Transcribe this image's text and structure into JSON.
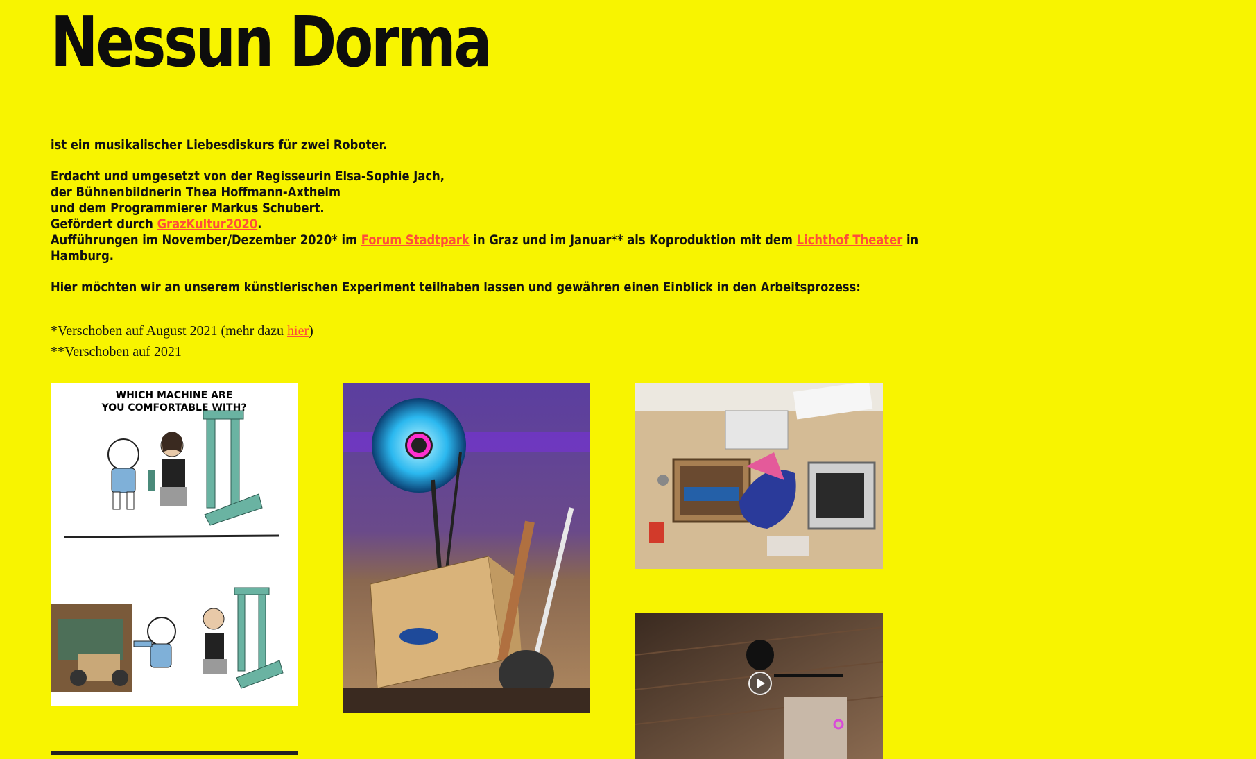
{
  "title": "Nessun Dorma",
  "intro": {
    "line1": "ist ein musikalischer Liebesdiskurs für zwei Roboter.",
    "credit1_prefix": "Erdacht und umgesetzt von der Regisseurin ",
    "credit1_name": "Elsa-Sophie Jach,",
    "credit2_prefix": "der Bühnenbildnerin ",
    "credit2_name": "Thea Hoffmann-Axthelm",
    "credit3_prefix": "und dem Programmierer ",
    "credit3_name": "Markus Schubert.",
    "funding_prefix": "Gefördert durch ",
    "funding_link": "GrazKultur2020",
    "funding_suffix": ".",
    "perf_prefix": "Aufführungen im November/Dezember 2020* im ",
    "perf_link1": "Forum Stadtpark",
    "perf_mid": " in Graz und im Januar** als Koproduktion mit dem ",
    "perf_link2": "Lichthof Theater",
    "perf_suffix": " in",
    "perf_line2": "Hamburg.",
    "experiment": "Hier möchten wir an unserem künstlerischen Experiment teilhaben lassen und gewähren einen Einblick in den Arbeitsprozess:"
  },
  "notes": {
    "note1_prefix": "*Verschoben auf August 2021 (mehr dazu ",
    "note1_link": "hier",
    "note1_suffix": ")",
    "note2": "**Verschoben auf 2021"
  },
  "gallery": {
    "comic_caption_line1": "WHICH MACHINE ARE",
    "comic_caption_line2": "YOU COMFORTABLE WITH?"
  },
  "colors": {
    "background": "#f8f400",
    "link": "#ff4d3a",
    "text": "#111111"
  }
}
